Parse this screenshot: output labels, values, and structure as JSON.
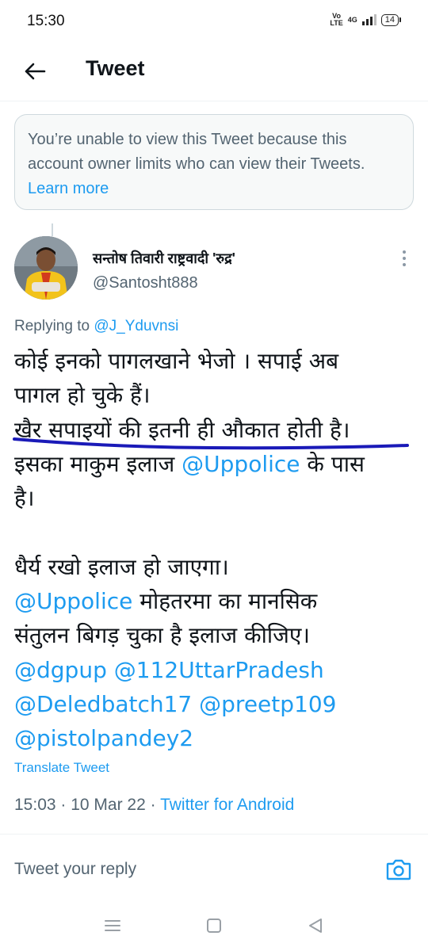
{
  "status_bar": {
    "time": "15:30",
    "network_top": "Vo",
    "network_bottom": "LTE",
    "network_type": "4G",
    "battery": "14"
  },
  "header": {
    "back_icon": "arrow-left-icon",
    "title": "Tweet"
  },
  "notice": {
    "text": "You’re unable to view this Tweet because this account owner limits who can view their Tweets.",
    "link": "Learn more"
  },
  "tweet": {
    "author_name": "सन्तोष तिवारी राष्ट्रवादी 'रुद्र'",
    "author_handle": "@Santosht888",
    "replying_prefix": "Replying to",
    "replying_to": "@J_Yduvnsi",
    "body": {
      "line1": "कोई इनको पागलखाने भेजो । सपाई अब",
      "line2": "पागल हो चुके हैं।",
      "line3": "खैर सपाइयों की इतनी ही औकात होती है।",
      "line4_pre": "इसका माकुम इलाज",
      "line4_mention": "@Uppolice",
      "line4_post": "के पास",
      "line5": "है।",
      "line7": "धैर्य रखो इलाज हो जाएगा।",
      "line8_mention": "@Uppolice",
      "line8_post": "मोहतरमा का मानसिक",
      "line9": "संतुलन बिगड़ चुका है इलाज कीजिए।",
      "line10_a": "@dgpup",
      "line10_b": "@112UttarPradesh",
      "line11_a": "@Deledbatch17",
      "line11_b": "@preetp109",
      "line12": "@pistolpandey2"
    },
    "translate": "Translate Tweet",
    "timestamp": "15:03 · 10 Mar 22 ·",
    "source": "Twitter for Android"
  },
  "reply": {
    "placeholder": "Tweet your reply",
    "camera_icon": "camera-icon"
  },
  "nav": {
    "menu_icon": "menu-icon",
    "home_icon": "square-home-icon",
    "back_icon": "triangle-back-icon"
  },
  "colors": {
    "accent": "#1d9bf0",
    "secondary_text": "#536471",
    "primary_text": "#0f1419",
    "underline_mark": "#1a1ab8"
  }
}
